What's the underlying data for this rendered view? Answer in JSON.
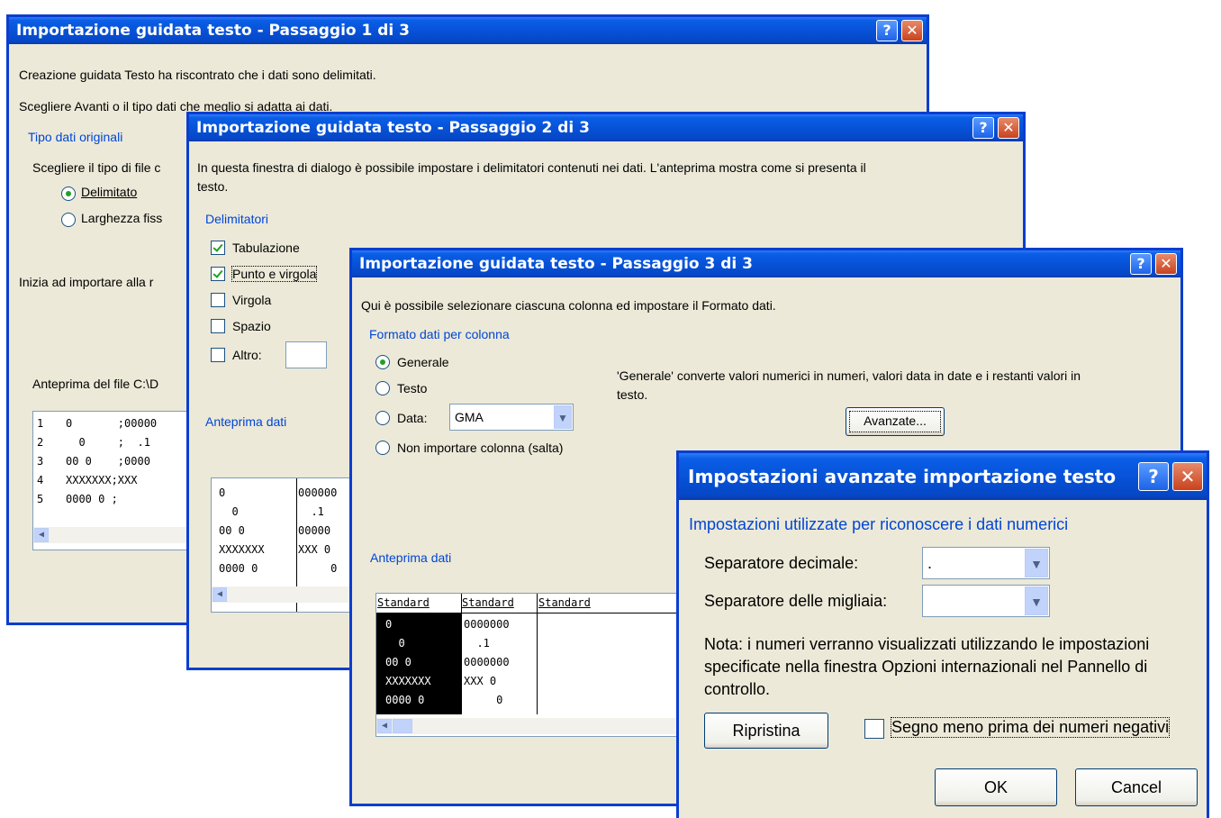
{
  "dialog1": {
    "title": "Importazione guidata testo - Passaggio 1 di 3",
    "intro1": "Creazione guidata Testo ha riscontrato che i dati sono delimitati.",
    "intro2": "Scegliere Avanti o il tipo dati che meglio si adatta ai dati.",
    "group_label": "Tipo dati originali",
    "choose_label": "Scegliere il tipo di file c",
    "radio_delimitato": "Delimitato",
    "radio_larghezza": "Larghezza fiss",
    "inizia_label": "Inizia ad importare alla r",
    "preview_label": "Anteprima del file C:\\D",
    "preview_rows": [
      {
        "num": "1",
        "text": "0       ;00000"
      },
      {
        "num": "2",
        "text": "  0     ;  .1"
      },
      {
        "num": "3",
        "text": "00 0    ;0000"
      },
      {
        "num": "4",
        "text": "XXXXXXX;XXX"
      },
      {
        "num": "5",
        "text": "0000 0 ;"
      }
    ]
  },
  "dialog2": {
    "title": "Importazione guidata testo - Passaggio 2 di 3",
    "intro": "In questa finestra di dialogo è possibile impostare i delimitatori contenuti nei dati. L'anteprima mostra come si presenta il",
    "intro_cont": "testo.",
    "group_label": "Delimitatori",
    "chk_tab": "Tabulazione",
    "chk_punto": "Punto e virgola",
    "chk_virgola": "Virgola",
    "chk_spazio": "Spazio",
    "chk_altro": "Altro:",
    "preview_label": "Anteprima dati",
    "preview_col1": [
      "0",
      "  0",
      "00 0",
      "XXXXXXX",
      "0000 0"
    ],
    "preview_col2": [
      "000000",
      "  .1",
      "00000",
      "XXX 0",
      "     0"
    ]
  },
  "dialog3": {
    "title": "Importazione guidata testo - Passaggio 3 di 3",
    "intro": "Qui è possibile selezionare ciascuna colonna ed impostare il Formato dati.",
    "group_label": "Formato dati per colonna",
    "radio_generale": "Generale",
    "radio_testo": "Testo",
    "radio_data": "Data:",
    "data_combo_value": "GMA",
    "radio_non_importare": "Non importare colonna (salta)",
    "desc_line1": "'Generale' converte valori numerici in numeri, valori data in date e i restanti valori in",
    "desc_line2": "testo.",
    "avanzate_button": "Avanzate...",
    "preview_label": "Anteprima dati",
    "preview_headers": [
      "Standard",
      "Standard",
      "Standard"
    ],
    "preview_col1": [
      "0",
      "  0",
      "00 0",
      "XXXXXXX",
      "0000 0"
    ],
    "preview_col2": [
      "0000000",
      "  .1",
      "0000000",
      "XXX 0",
      "     0"
    ]
  },
  "dialog4": {
    "title": "Impostazioni avanzate importazione testo",
    "group_label": "Impostazioni utilizzate per riconoscere i dati numerici",
    "decimal_label": "Separatore decimale:",
    "decimal_value": ".",
    "thousands_label": "Separatore delle migliaia:",
    "thousands_value": "",
    "note_line1": "Nota: i numeri verranno visualizzati utilizzando le impostazioni",
    "note_line2": "specificate nella finestra Opzioni internazionali nel Pannello di",
    "note_line3": "controllo.",
    "reset_button": "Ripristina",
    "minus_checkbox": "Segno meno prima dei numeri negativi",
    "ok_button": "OK",
    "cancel_button": "Cancel"
  },
  "titlebar": {
    "help_glyph": "?",
    "close_glyph": "✕"
  }
}
